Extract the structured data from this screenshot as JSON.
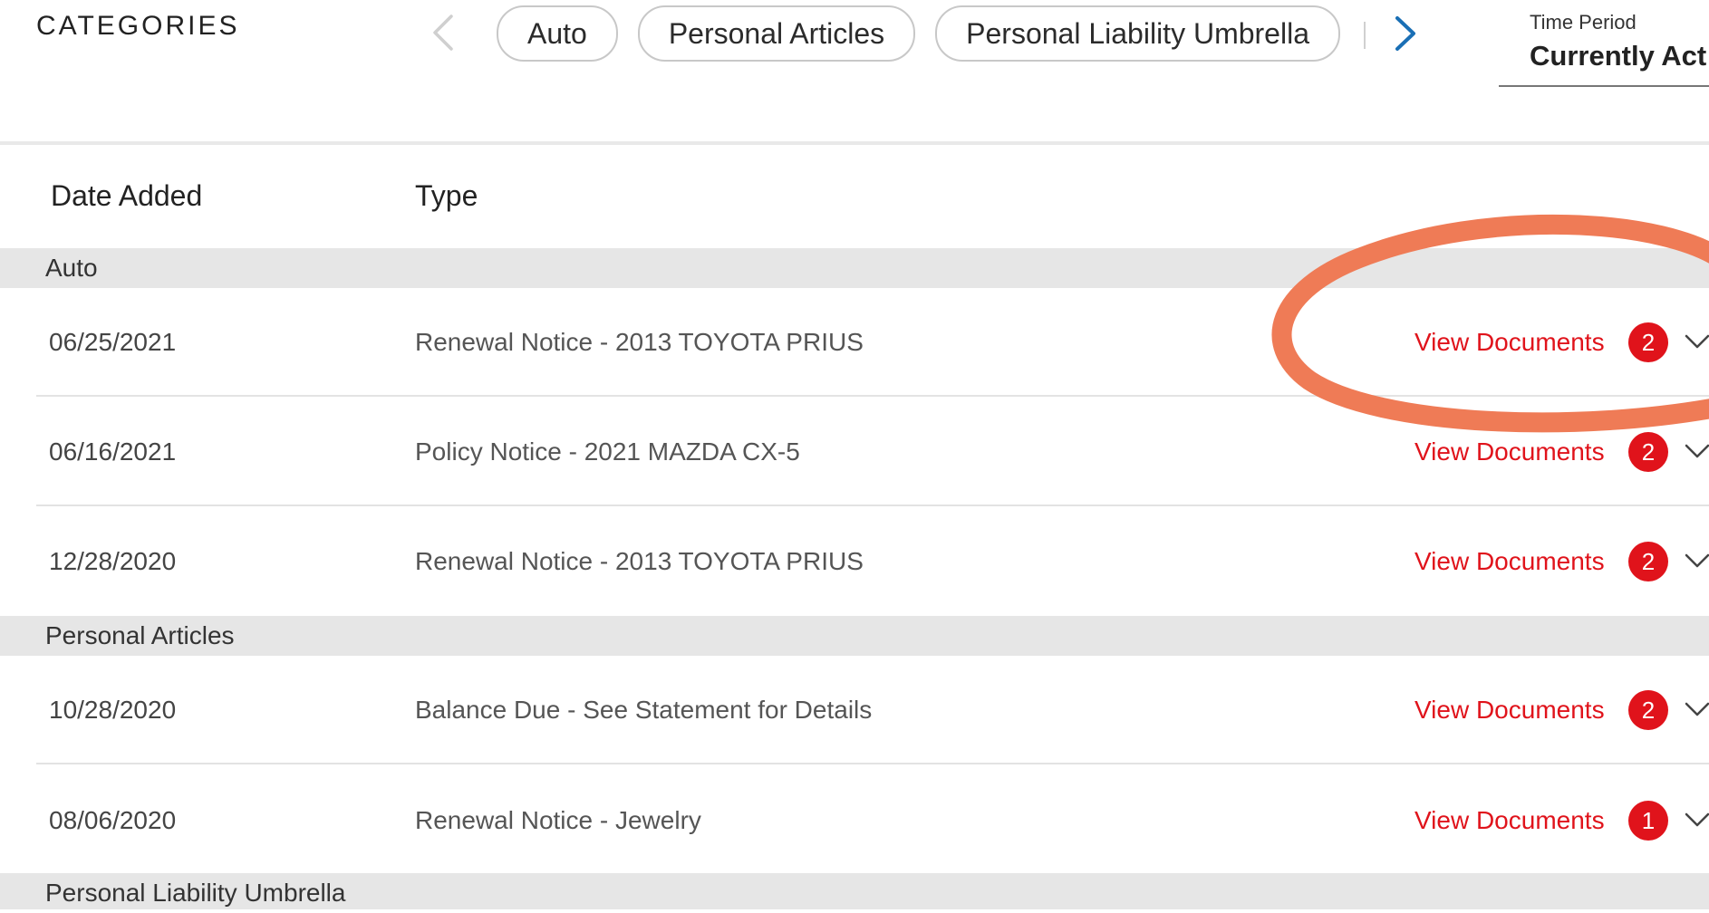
{
  "header": {
    "categories_label": "CATEGORIES",
    "chips": [
      "Auto",
      "Personal Articles",
      "Personal Liability Umbrella"
    ],
    "time_period": {
      "label": "Time Period",
      "value": "Currently Act"
    }
  },
  "table": {
    "columns": {
      "date": "Date Added",
      "type": "Type"
    },
    "groups": [
      {
        "name": "Auto"
      },
      {
        "name": "Personal Articles"
      },
      {
        "name": "Personal Liability Umbrella"
      }
    ],
    "rows": [
      {
        "date": "06/25/2021",
        "type": "Renewal Notice - 2013 TOYOTA PRIUS",
        "link": "View Documents",
        "count": "2"
      },
      {
        "date": "06/16/2021",
        "type": "Policy Notice - 2021 MAZDA CX-5",
        "link": "View Documents",
        "count": "2"
      },
      {
        "date": "12/28/2020",
        "type": "Renewal Notice - 2013 TOYOTA PRIUS",
        "link": "View Documents",
        "count": "2"
      },
      {
        "date": "10/28/2020",
        "type": "Balance Due - See Statement for Details",
        "link": "View Documents",
        "count": "2"
      },
      {
        "date": "08/06/2020",
        "type": "Renewal Notice - Jewelry",
        "link": "View Documents",
        "count": "1"
      }
    ]
  },
  "colors": {
    "accent_red": "#e0131b",
    "nav_blue": "#1a6fb5",
    "annotation_orange": "#ef7b56",
    "group_bg": "#e6e6e6"
  },
  "icons": {
    "prev": "chevron-left-icon",
    "next": "chevron-right-icon",
    "expand": "chevron-down-icon"
  },
  "annotation": {
    "type": "hand-drawn ellipse",
    "target": "first View Documents link"
  }
}
